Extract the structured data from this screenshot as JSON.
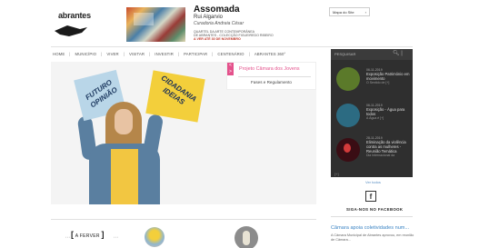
{
  "header": {
    "logo_text": "abrantes",
    "logo_subtext": "",
    "promo_title": "Assomada",
    "promo_subtitle": "Rui Algarvio",
    "promo_curator": "Curadoria Andreia César",
    "promo_line1": "QUARTEL DA ARTE CONTEMPORÂNEA",
    "promo_line2": "DE ABRANTES - COLECÇÃO FIGUEIREDO RIBEIRO",
    "promo_line3": "A VER ATÉ 30 DE NOVEMBRO",
    "sitemap_label": "Mapa do Site"
  },
  "nav": {
    "items": [
      "HOME",
      "MUNICÍPIO",
      "VIVER",
      "VISITAR",
      "INVESTIR",
      "PARTICIPAR",
      "CENTENÁRIO",
      "ABRANTES 360°"
    ]
  },
  "hero": {
    "sign_left": "FUTURO OPINIÃO",
    "sign_right": "CIDADANIA IDEIAS",
    "project_title": "Projeto Câmara dos Jovens",
    "project_link": "Fases e Regulamento"
  },
  "sidebar": {
    "label": "PESQUISAR",
    "news": [
      {
        "date": "06-11-2019",
        "title": "Exposição Património em movimento",
        "meta": "O Sentido de [+]"
      },
      {
        "date": "06-11-2019",
        "title": "Exposição - Água para todos",
        "meta": "A Água é [+]"
      },
      {
        "date": "28-11-2019",
        "title": "Eliminação da violência contra as mulheres - Reunião Temática",
        "meta": "Dia Internacional da"
      }
    ],
    "footer": "[+]",
    "see_all": "Ver todos",
    "facebook_text": "SIGA-NOS NO FACEBOOK",
    "news_title": "Câmara apoia coletividades num...",
    "news_desc": "A Câmara Municipal de Abrantes aprovou, em reunião de Câmara..."
  },
  "bottom": {
    "section_label": "A FERVER"
  },
  "colors": {
    "accent_pink": "#e4528c",
    "link_blue": "#3b84c4",
    "panel_dark": "#2f2f2f"
  }
}
